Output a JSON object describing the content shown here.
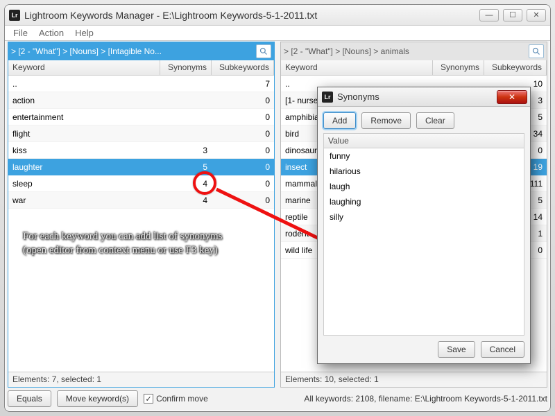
{
  "window": {
    "title": "Lightroom Keywords Manager - E:\\Lightroom Keywords-5-1-2011.txt"
  },
  "menus": {
    "file": "File",
    "action": "Action",
    "help": "Help"
  },
  "columns": {
    "keyword": "Keyword",
    "synonyms": "Synonyms",
    "subkeywords": "Subkeywords"
  },
  "leftPane": {
    "breadcrumb": "> [2 - \"What\"] > [Nouns] > [Intagible No...",
    "rows": [
      {
        "k": "..",
        "s": "",
        "sub": "7"
      },
      {
        "k": "action",
        "s": "",
        "sub": "0"
      },
      {
        "k": "entertainment",
        "s": "",
        "sub": "0"
      },
      {
        "k": "flight",
        "s": "",
        "sub": "0"
      },
      {
        "k": "kiss",
        "s": "3",
        "sub": "0"
      },
      {
        "k": "laughter",
        "s": "5",
        "sub": "0"
      },
      {
        "k": "sleep",
        "s": "4",
        "sub": "0"
      },
      {
        "k": "war",
        "s": "4",
        "sub": "0"
      }
    ],
    "selectedIndex": 5,
    "status": "Elements: 7, selected: 1"
  },
  "rightPane": {
    "breadcrumb": "> [2 - \"What\"] > [Nouns] > animals",
    "rows": [
      {
        "k": "..",
        "s": "",
        "sub": "10"
      },
      {
        "k": "[1- nursery]",
        "s": "",
        "sub": "3"
      },
      {
        "k": "amphibian",
        "s": "",
        "sub": "5"
      },
      {
        "k": "bird",
        "s": "",
        "sub": "34"
      },
      {
        "k": "dinosaur",
        "s": "",
        "sub": "0"
      },
      {
        "k": "insect",
        "s": "",
        "sub": "19"
      },
      {
        "k": "mammal",
        "s": "",
        "sub": "111"
      },
      {
        "k": "marine",
        "s": "",
        "sub": "5"
      },
      {
        "k": "reptile",
        "s": "",
        "sub": "14"
      },
      {
        "k": "rodent",
        "s": "",
        "sub": "1"
      },
      {
        "k": "wild life",
        "s": "",
        "sub": "0"
      }
    ],
    "selectedIndex": 5,
    "status": "Elements: 10, selected: 1"
  },
  "bottom": {
    "equals": "Equals",
    "move": "Move keyword(s)",
    "confirm": "Confirm move",
    "status": "All keywords: 2108, filename: E:\\Lightroom Keywords-5-1-2011.txt"
  },
  "hint": "For each keyword you can add list of synonyms (open editor from context menu or use F3 key)",
  "dialog": {
    "title": "Synonyms",
    "add": "Add",
    "remove": "Remove",
    "clear": "Clear",
    "colhead": "Value",
    "items": [
      "funny",
      "hilarious",
      "laugh",
      "laughing",
      "silly"
    ],
    "save": "Save",
    "cancel": "Cancel"
  }
}
